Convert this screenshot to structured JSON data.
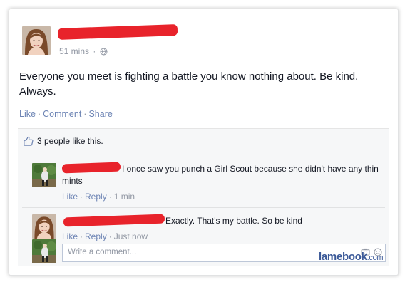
{
  "post": {
    "time": "51 mins",
    "audience_icon": "globe-icon",
    "text": "Everyone you meet is fighting a battle you know nothing about. Be kind. Always.",
    "actions": {
      "like": "Like",
      "comment": "Comment",
      "share": "Share"
    },
    "likes_summary": "3 people like this."
  },
  "comments": [
    {
      "text": "I once saw you punch a Girl Scout because she didn't have any thin mints",
      "like": "Like",
      "reply": "Reply",
      "time": "1 min"
    },
    {
      "text": "Exactly. That's my battle. So be kind",
      "like": "Like",
      "reply": "Reply",
      "time": "Just now"
    }
  ],
  "composer": {
    "placeholder": "Write a comment...",
    "icons": [
      "camera-icon",
      "emoticon-icon"
    ]
  },
  "watermark": {
    "brand": "lamebook",
    "suffix": ".com"
  },
  "colors": {
    "link": "#6d84b4",
    "meta": "#9197a3",
    "redaction": "#e8232b",
    "brand": "#3b5998"
  }
}
